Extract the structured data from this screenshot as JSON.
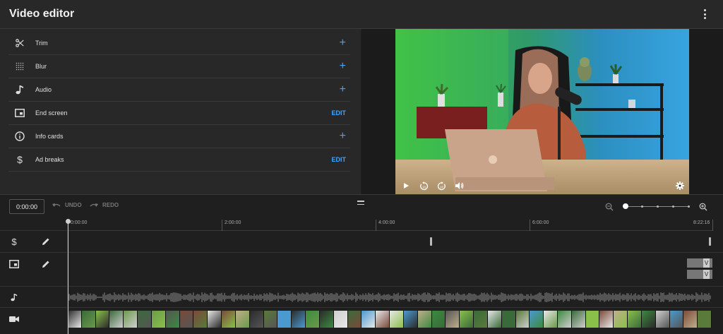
{
  "header": {
    "title": "Video editor",
    "more_icon": "vertical-dots-icon"
  },
  "tools": [
    {
      "label": "Trim",
      "icon": "scissors-icon",
      "action": "+"
    },
    {
      "label": "Blur",
      "icon": "blur-grid-icon",
      "action": "+"
    },
    {
      "label": "Audio",
      "icon": "music-note-icon",
      "action": "+"
    },
    {
      "label": "End screen",
      "icon": "end-screen-icon",
      "action": "EDIT"
    },
    {
      "label": "Info cards",
      "icon": "info-icon",
      "action": "+"
    },
    {
      "label": "Ad breaks",
      "icon": "dollar-icon",
      "action": "EDIT"
    }
  ],
  "player": {
    "controls": [
      "play-icon",
      "rewind-10-icon",
      "forward-10-icon",
      "volume-icon",
      "gear-icon"
    ]
  },
  "timeline_toolbar": {
    "current_time": "0:00:00",
    "undo_label": "UNDO",
    "redo_label": "REDO"
  },
  "ruler": {
    "labels": [
      "0:00:00",
      "2:00:00",
      "4:00:00",
      "6:00:00",
      "8:22:16"
    ]
  },
  "tracks": {
    "ad_breaks_icon": "dollar-icon",
    "end_screen_icon": "end-screen-icon",
    "audio_icon": "music-note-icon",
    "video_icon": "video-camera-icon",
    "end_screen_element_label": "V"
  },
  "colors": {
    "accent": "#3ea6ff",
    "background": "#1f1f1f",
    "panel": "#282828"
  }
}
